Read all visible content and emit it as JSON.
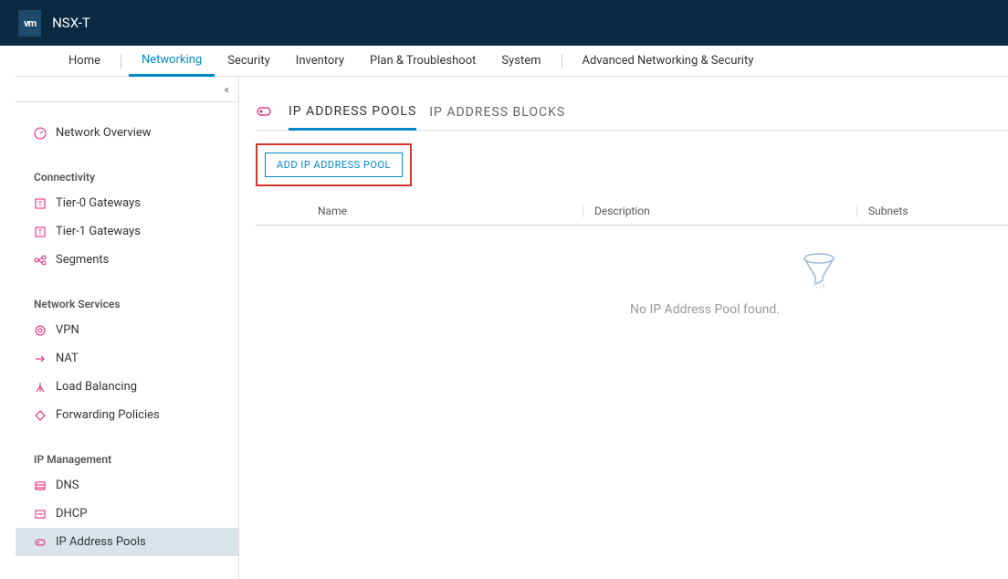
{
  "header": {
    "logo": "vm",
    "title": "NSX-T"
  },
  "topnav": {
    "items": [
      "Home",
      "Networking",
      "Security",
      "Inventory",
      "Plan & Troubleshoot",
      "System",
      "Advanced Networking & Security"
    ],
    "active_index": 1
  },
  "sidebar": {
    "sections": [
      {
        "heading": null,
        "items": [
          {
            "label": "Network Overview",
            "icon": "dashboard-icon"
          }
        ]
      },
      {
        "heading": "Connectivity",
        "items": [
          {
            "label": "Tier-0 Gateways",
            "icon": "gateway-icon"
          },
          {
            "label": "Tier-1 Gateways",
            "icon": "gateway-icon"
          },
          {
            "label": "Segments",
            "icon": "segments-icon"
          }
        ]
      },
      {
        "heading": "Network Services",
        "items": [
          {
            "label": "VPN",
            "icon": "vpn-icon"
          },
          {
            "label": "NAT",
            "icon": "nat-icon"
          },
          {
            "label": "Load Balancing",
            "icon": "loadbalance-icon"
          },
          {
            "label": "Forwarding Policies",
            "icon": "forward-icon"
          }
        ]
      },
      {
        "heading": "IP Management",
        "items": [
          {
            "label": "DNS",
            "icon": "dns-icon"
          },
          {
            "label": "DHCP",
            "icon": "dhcp-icon"
          },
          {
            "label": "IP Address Pools",
            "icon": "ip-pool-icon",
            "active": true
          }
        ]
      }
    ]
  },
  "content": {
    "tabs": [
      "IP ADDRESS POOLS",
      "IP ADDRESS BLOCKS"
    ],
    "active_tab_index": 0,
    "action_button": "ADD IP ADDRESS POOL",
    "table_columns": [
      "Name",
      "Description",
      "Subnets"
    ],
    "empty_message": "No IP Address Pool found."
  }
}
